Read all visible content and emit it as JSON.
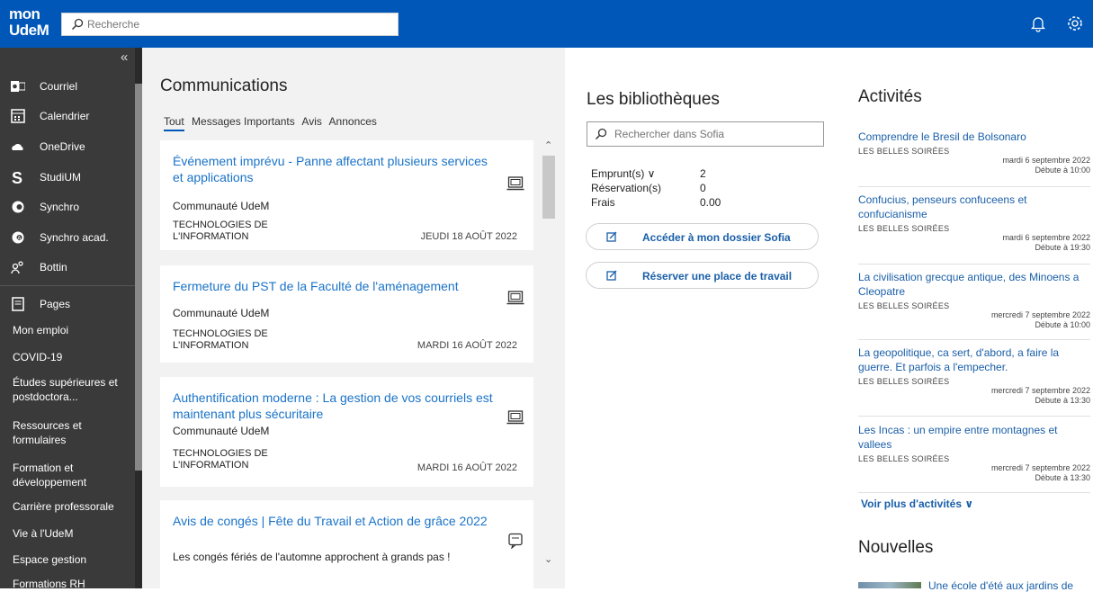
{
  "header": {
    "logo_line1": "mon",
    "logo_line2": "UdeM",
    "search_placeholder": "Recherche"
  },
  "sidebar": {
    "apps": [
      {
        "label": "Courriel",
        "icon": "outlook-icon"
      },
      {
        "label": "Calendrier",
        "icon": "calendar-icon"
      },
      {
        "label": "OneDrive",
        "icon": "onedrive-icon"
      },
      {
        "label": "StudiUM",
        "icon": "studium-icon"
      },
      {
        "label": "Synchro",
        "icon": "synchro-icon"
      },
      {
        "label": "Synchro acad.",
        "icon": "synchro-acad-icon"
      },
      {
        "label": "Bottin",
        "icon": "directory-icon"
      }
    ],
    "pages_label": "Pages",
    "links": [
      "Mon emploi",
      "COVID-19",
      "Études supérieures et postdoctora...",
      "Ressources et formulaires",
      "Formation et développement",
      "Carrière professorale",
      "Vie à l'UdeM",
      "Espace gestion",
      "Formations RH"
    ]
  },
  "communications": {
    "title": "Communications",
    "tabs": [
      "Tout",
      "Messages Importants",
      "Avis",
      "Annonces"
    ],
    "cards": [
      {
        "title": "Événement imprévu - Panne affectant plusieurs services et applications",
        "source": "Communauté UdeM",
        "category": "TECHNOLOGIES DE L'INFORMATION",
        "date": "JEUDI 18 AOÛT 2022"
      },
      {
        "title": "Fermeture du PST de la Faculté de l'aménagement",
        "source": "Communauté UdeM",
        "category": "TECHNOLOGIES DE L'INFORMATION",
        "date": "MARDI 16 AOÛT 2022"
      },
      {
        "title": "Authentification moderne : La gestion de vos courriels est maintenant plus sécuritaire",
        "source": "Communauté UdeM",
        "category": "TECHNOLOGIES DE L'INFORMATION",
        "date": "MARDI 16 AOÛT 2022"
      },
      {
        "title": "Avis de congés | Fête du Travail et Action de grâce 2022",
        "source": "Les congés fériés de l'automne approchent à grands pas !",
        "category": "",
        "date": ""
      }
    ]
  },
  "library": {
    "title": "Les bibliothèques",
    "search_placeholder": "Rechercher dans Sofia",
    "stats": [
      {
        "label": "Emprunt(s) ∨",
        "value": "2"
      },
      {
        "label": "Réservation(s)",
        "value": "0"
      },
      {
        "label": "Frais",
        "value": "0.00"
      }
    ],
    "buttons": [
      "Accéder à mon dossier Sofia",
      "Réserver une place de travail"
    ]
  },
  "activities": {
    "title": "Activités",
    "items": [
      {
        "title": "Comprendre le Bresil de Bolsonaro",
        "source": "LES BELLES SOIRÉES",
        "date": "mardi 6 septembre 2022",
        "time": "Débute à 10:00"
      },
      {
        "title": "Confucius, penseurs confuceens et confucianisme",
        "source": "LES BELLES SOIRÉES",
        "date": "mardi 6 septembre 2022",
        "time": "Débute à 19:30"
      },
      {
        "title": "La civilisation grecque antique, des Minoens a Cleopatre",
        "source": "LES BELLES SOIRÉES",
        "date": "mercredi 7 septembre 2022",
        "time": "Débute à 10:00"
      },
      {
        "title": "La geopolitique, ca sert, d'abord, a faire la guerre. Et parfois a l'empecher.",
        "source": "LES BELLES SOIRÉES",
        "date": "mercredi 7 septembre 2022",
        "time": "Débute à 13:30"
      },
      {
        "title": "Les Incas : un empire entre montagnes et vallees",
        "source": "LES BELLES SOIRÉES",
        "date": "mercredi 7 septembre 2022",
        "time": "Débute à 13:30"
      }
    ],
    "more_label": "Voir plus d'activités ∨"
  },
  "news": {
    "title": "Nouvelles",
    "first_item": "Une école d'été aux jardins de"
  },
  "colors": {
    "brand": "#0057b8",
    "sidebar": "#3a3a3a",
    "link": "#1a73c8"
  }
}
